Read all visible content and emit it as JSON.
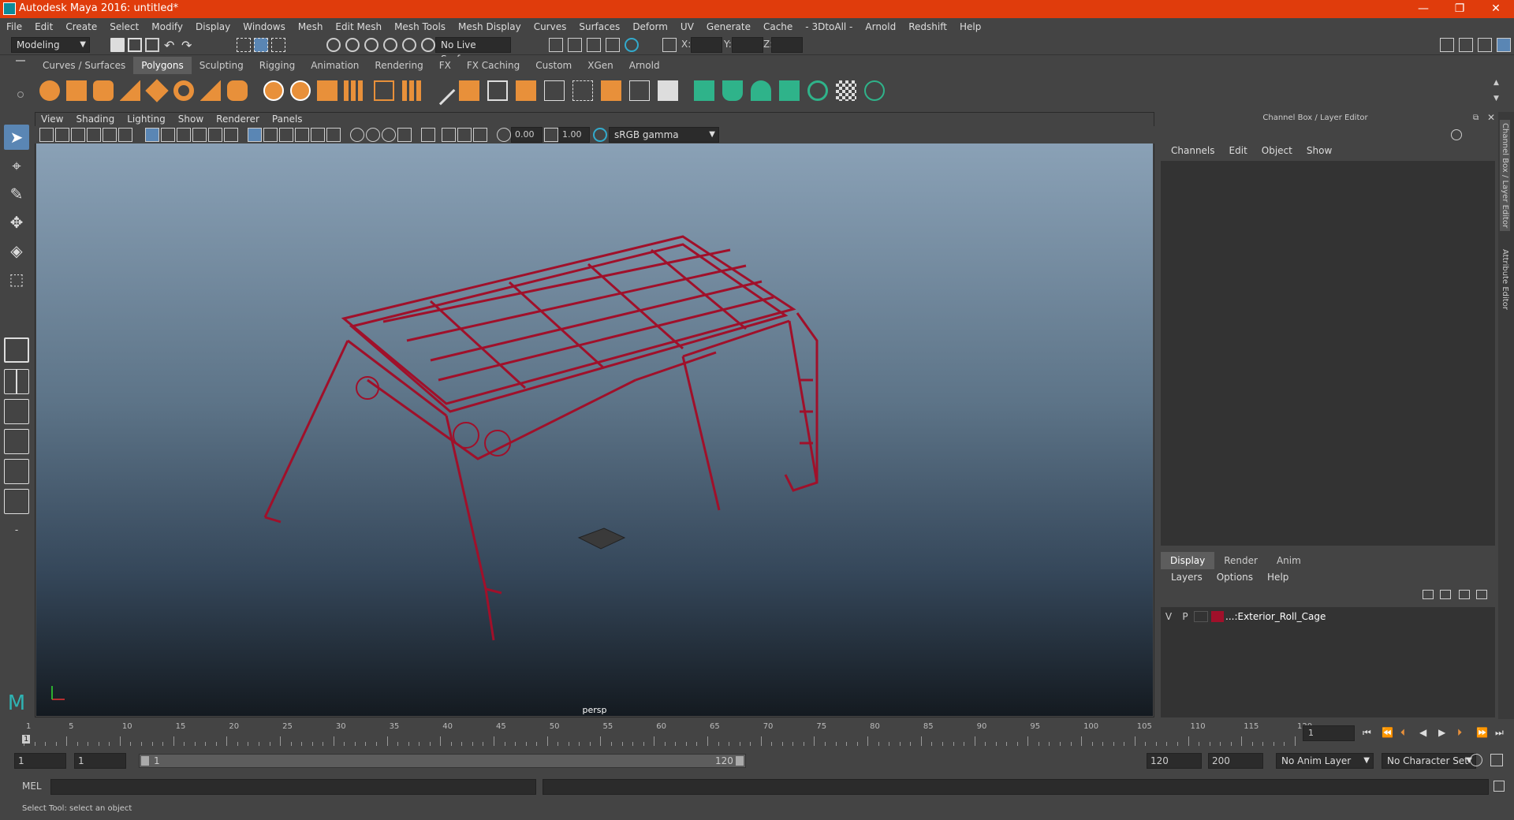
{
  "window": {
    "title": "Autodesk Maya 2016: untitled*",
    "controls": [
      "—",
      "❐",
      "✕"
    ]
  },
  "menubar": [
    "File",
    "Edit",
    "Create",
    "Select",
    "Modify",
    "Display",
    "Windows",
    "Mesh",
    "Edit Mesh",
    "Mesh Tools",
    "Mesh Display",
    "Curves",
    "Surfaces",
    "Deform",
    "UV",
    "Generate",
    "Cache",
    "- 3DtoAll -",
    "Arnold",
    "Redshift",
    "Help"
  ],
  "statusline": {
    "mode": "Modeling",
    "live_surface": "No Live Surface",
    "x_label": "X:",
    "y_label": "Y:",
    "z_label": "Z:"
  },
  "shelf_tabs": {
    "items": [
      "Curves / Surfaces",
      "Polygons",
      "Sculpting",
      "Rigging",
      "Animation",
      "Rendering",
      "FX",
      "FX Caching",
      "Custom",
      "XGen",
      "Arnold"
    ],
    "active": "Polygons"
  },
  "viewport": {
    "menu": [
      "View",
      "Shading",
      "Lighting",
      "Show",
      "Renderer",
      "Panels"
    ],
    "exposure": "0.00",
    "gamma": "1.00",
    "color_space": "sRGB gamma",
    "camera_label": "persp"
  },
  "channel_box": {
    "title": "Channel Box / Layer Editor",
    "menu": [
      "Channels",
      "Edit",
      "Object",
      "Show"
    ]
  },
  "layer_editor": {
    "tabs": [
      "Display",
      "Render",
      "Anim"
    ],
    "active_tab": "Display",
    "menu": [
      "Layers",
      "Options",
      "Help"
    ],
    "layer": {
      "v": "V",
      "p": "P",
      "name": "...:Exterior_Roll_Cage",
      "color": "#a0102a"
    }
  },
  "side_tabs": [
    "Channel Box / Layer Editor",
    "Attribute Editor"
  ],
  "timeline": {
    "ticks": [
      1,
      5,
      10,
      15,
      20,
      25,
      30,
      35,
      40,
      45,
      50,
      55,
      60,
      65,
      70,
      75,
      80,
      85,
      90,
      95,
      100,
      105,
      110,
      115,
      120
    ],
    "current_frame": "1",
    "current_marker": "1"
  },
  "range": {
    "start": "1",
    "start2": "1",
    "slider_start": "1",
    "slider_end": "120",
    "end": "120",
    "end2": "200",
    "anim_layer": "No Anim Layer",
    "char_set": "No Character Set"
  },
  "cmdline": {
    "label": "MEL"
  },
  "helpline": {
    "text": "Select Tool: select an object"
  },
  "colors": {
    "title_bar": "#e03c0c",
    "wire": "#a0102a",
    "accent": "#0c8a9a"
  }
}
